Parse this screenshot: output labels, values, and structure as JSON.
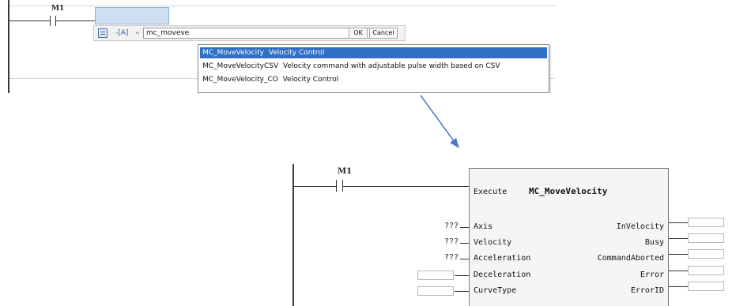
{
  "top_editor": {
    "contact_label": "M1",
    "instruction_bar": {
      "type_label": "-[A]",
      "search_value": "mc_moveve",
      "ok_label": "OK",
      "cancel_label": "Cancel"
    },
    "suggestions": [
      {
        "name": "MC_MoveVelocity",
        "description": "Velocity Control",
        "selected": true
      },
      {
        "name": "MC_MoveVelocityCSV",
        "description": "Velocity command with adjustable pulse width based on CSV",
        "selected": false
      },
      {
        "name": "MC_MoveVelocity_CO",
        "description": "Velocity Control",
        "selected": false
      }
    ]
  },
  "bottom_editor": {
    "contact_label": "M1",
    "function_block": {
      "execute_label": "Execute",
      "title": "MC_MoveVelocity",
      "inputs": [
        {
          "label": "Axis",
          "value": "???"
        },
        {
          "label": "Velocity",
          "value": "???"
        },
        {
          "label": "Acceleration",
          "value": "???"
        },
        {
          "label": "Deceleration",
          "value": ""
        },
        {
          "label": "CurveType",
          "value": ""
        }
      ],
      "outputs": [
        {
          "label": "InVelocity"
        },
        {
          "label": "Busy"
        },
        {
          "label": "CommandAborted"
        },
        {
          "label": "Error"
        },
        {
          "label": "ErrorID"
        }
      ]
    }
  },
  "colors": {
    "selection_bg": "#2f6fc4",
    "arrow": "#4a78c2",
    "selected_cell": "#cfe0f2"
  }
}
